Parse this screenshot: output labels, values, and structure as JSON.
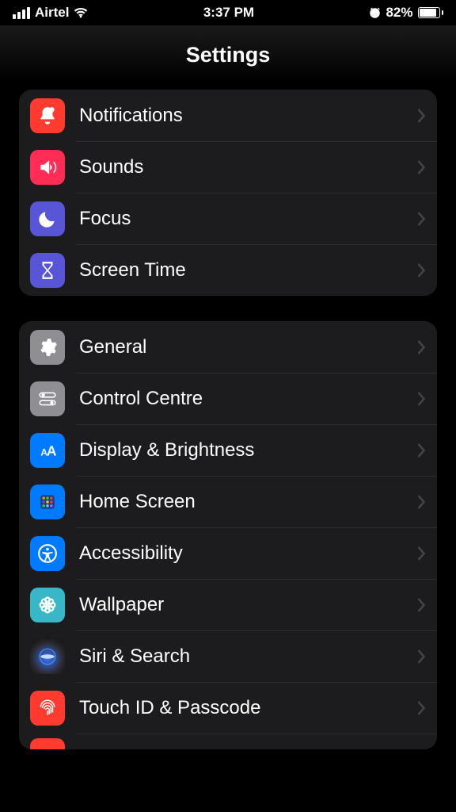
{
  "status": {
    "carrier": "Airtel",
    "time": "3:37 PM",
    "battery_pct": "82%"
  },
  "title": "Settings",
  "groups": [
    {
      "rows": [
        {
          "label": "Notifications"
        },
        {
          "label": "Sounds"
        },
        {
          "label": "Focus"
        },
        {
          "label": "Screen Time"
        }
      ]
    },
    {
      "rows": [
        {
          "label": "General"
        },
        {
          "label": "Control Centre"
        },
        {
          "label": "Display & Brightness"
        },
        {
          "label": "Home Screen"
        },
        {
          "label": "Accessibility"
        },
        {
          "label": "Wallpaper"
        },
        {
          "label": "Siri & Search"
        },
        {
          "label": "Touch ID & Passcode"
        }
      ]
    }
  ]
}
